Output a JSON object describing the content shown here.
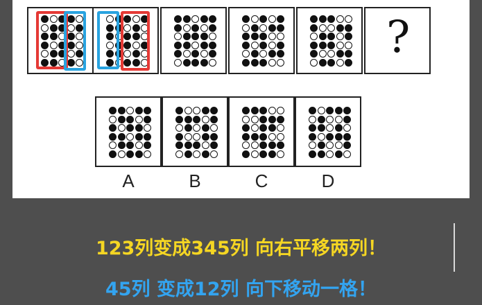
{
  "question_mark": "?",
  "options": [
    {
      "label": "A"
    },
    {
      "label": "B"
    },
    {
      "label": "C"
    },
    {
      "label": "D"
    }
  ],
  "captions": {
    "line1": "123列变成345列  向右平移两列！",
    "line2": "45列 变成12列   向下移动一格！"
  },
  "colors": {
    "background": "#4e4e4e",
    "line1_text": "#f5d623",
    "line2_text": "#33a4f0",
    "highlight_red": "#e53935",
    "highlight_blue": "#29a3e0",
    "dot": "#111111"
  },
  "grids": {
    "cols": 5,
    "rows": 6,
    "top_row": [
      [
        "10110",
        "01101",
        "11010",
        "10110",
        "01101",
        "11010"
      ],
      [
        "01101",
        "11010",
        "10110",
        "01101",
        "11010",
        "10110"
      ],
      [
        "11011",
        "10101",
        "01110",
        "11011",
        "10101",
        "01110"
      ],
      [
        "10101",
        "01011",
        "11100",
        "10101",
        "01011",
        "11100"
      ],
      [
        "11100",
        "10011",
        "01101",
        "11100",
        "10011",
        "01101"
      ]
    ],
    "options": [
      [
        "11011",
        "01101",
        "10110",
        "11011",
        "01101",
        "10110"
      ],
      [
        "10011",
        "11101",
        "01010",
        "10011",
        "11101",
        "01010"
      ],
      [
        "11100",
        "00111",
        "10110",
        "11100",
        "00111",
        "10110"
      ],
      [
        "10111",
        "01001",
        "11010",
        "10111",
        "01001",
        "11010"
      ]
    ]
  }
}
